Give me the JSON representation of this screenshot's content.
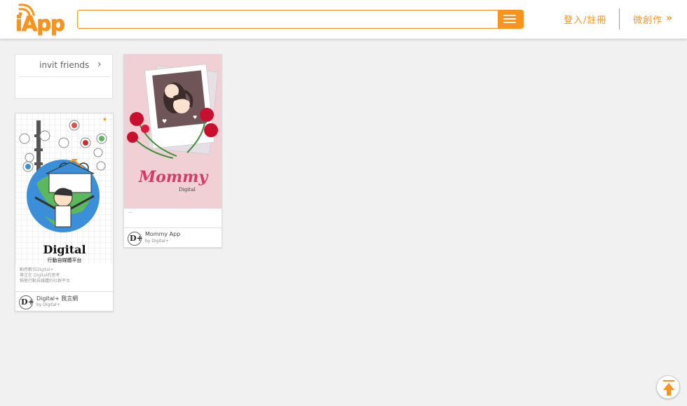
{
  "header": {
    "logo_text": "iApp",
    "search_placeholder": "",
    "login_label": "登入/註冊",
    "create_label": "微創作",
    "create_arrow": "»"
  },
  "invite": {
    "label": "invit friends",
    "chevron": "›"
  },
  "apps": [
    {
      "name": "Digital+ 我言網",
      "by": "by  Digital+",
      "description": [
        "動感數位Digital+",
        "專注在 Digital的思考",
        "積極行動自媒體的社群平台"
      ],
      "poster_title": "Digital",
      "poster_subtitle": "行動自媒體平台"
    },
    {
      "name": "Mommy App",
      "by": "by  Digital+",
      "description": [
        "---"
      ],
      "poster_title": "Mommy",
      "poster_subtitle": "Digital"
    }
  ],
  "brand_mark": "D+",
  "icons": {
    "menu": "menu-icon",
    "chevron": "chevron-right-icon",
    "scroll_top": "arrow-up-icon",
    "favorite": "star-icon"
  },
  "colors": {
    "accent": "#f7931e",
    "background": "#f1f1f1",
    "poster_pink": "#f0d0d4",
    "mommy_text": "#d43a6a"
  }
}
